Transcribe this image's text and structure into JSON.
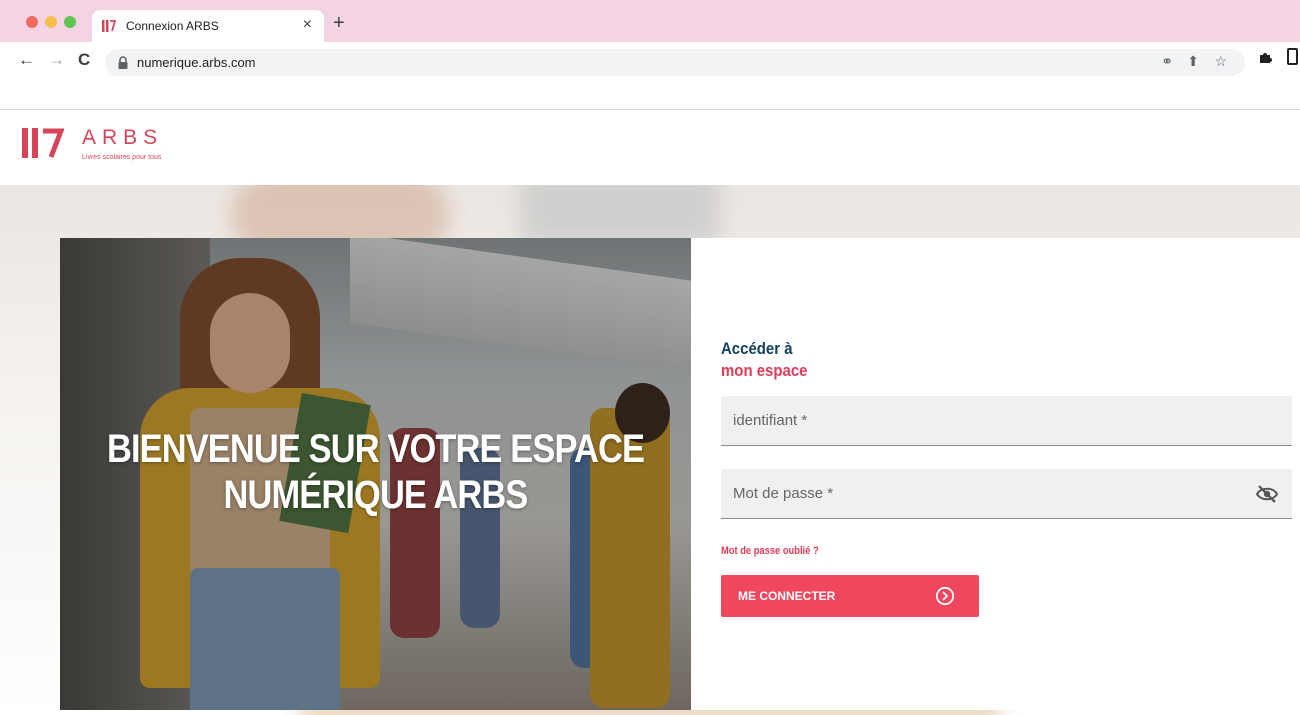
{
  "browser": {
    "tab_title": "Connexion ARBS",
    "tab_close": "×",
    "new_tab": "+",
    "url": "numerique.arbs.com",
    "icons": [
      "back-icon",
      "forward-icon",
      "reload-icon",
      "lock-icon",
      "key-icon",
      "share-icon",
      "star-icon",
      "extensions-icon",
      "sidebar-icon"
    ]
  },
  "brand": {
    "name": "ARBS",
    "tagline": "Livres scolaires pour tous",
    "color": "#d6455a"
  },
  "hero": {
    "title": "BIENVENUE SUR VOTRE ESPACE NUMÉRIQUE ARBS"
  },
  "login": {
    "heading_line1": "Accéder à",
    "heading_line2": "mon espace",
    "username_placeholder": "identifiant *",
    "password_placeholder": "Mot de passe *",
    "forgot_password": "Mot de passe oublié ?",
    "submit_label": "ME CONNECTER",
    "accent_color": "#f0465e",
    "heading_color": "#13405b"
  }
}
